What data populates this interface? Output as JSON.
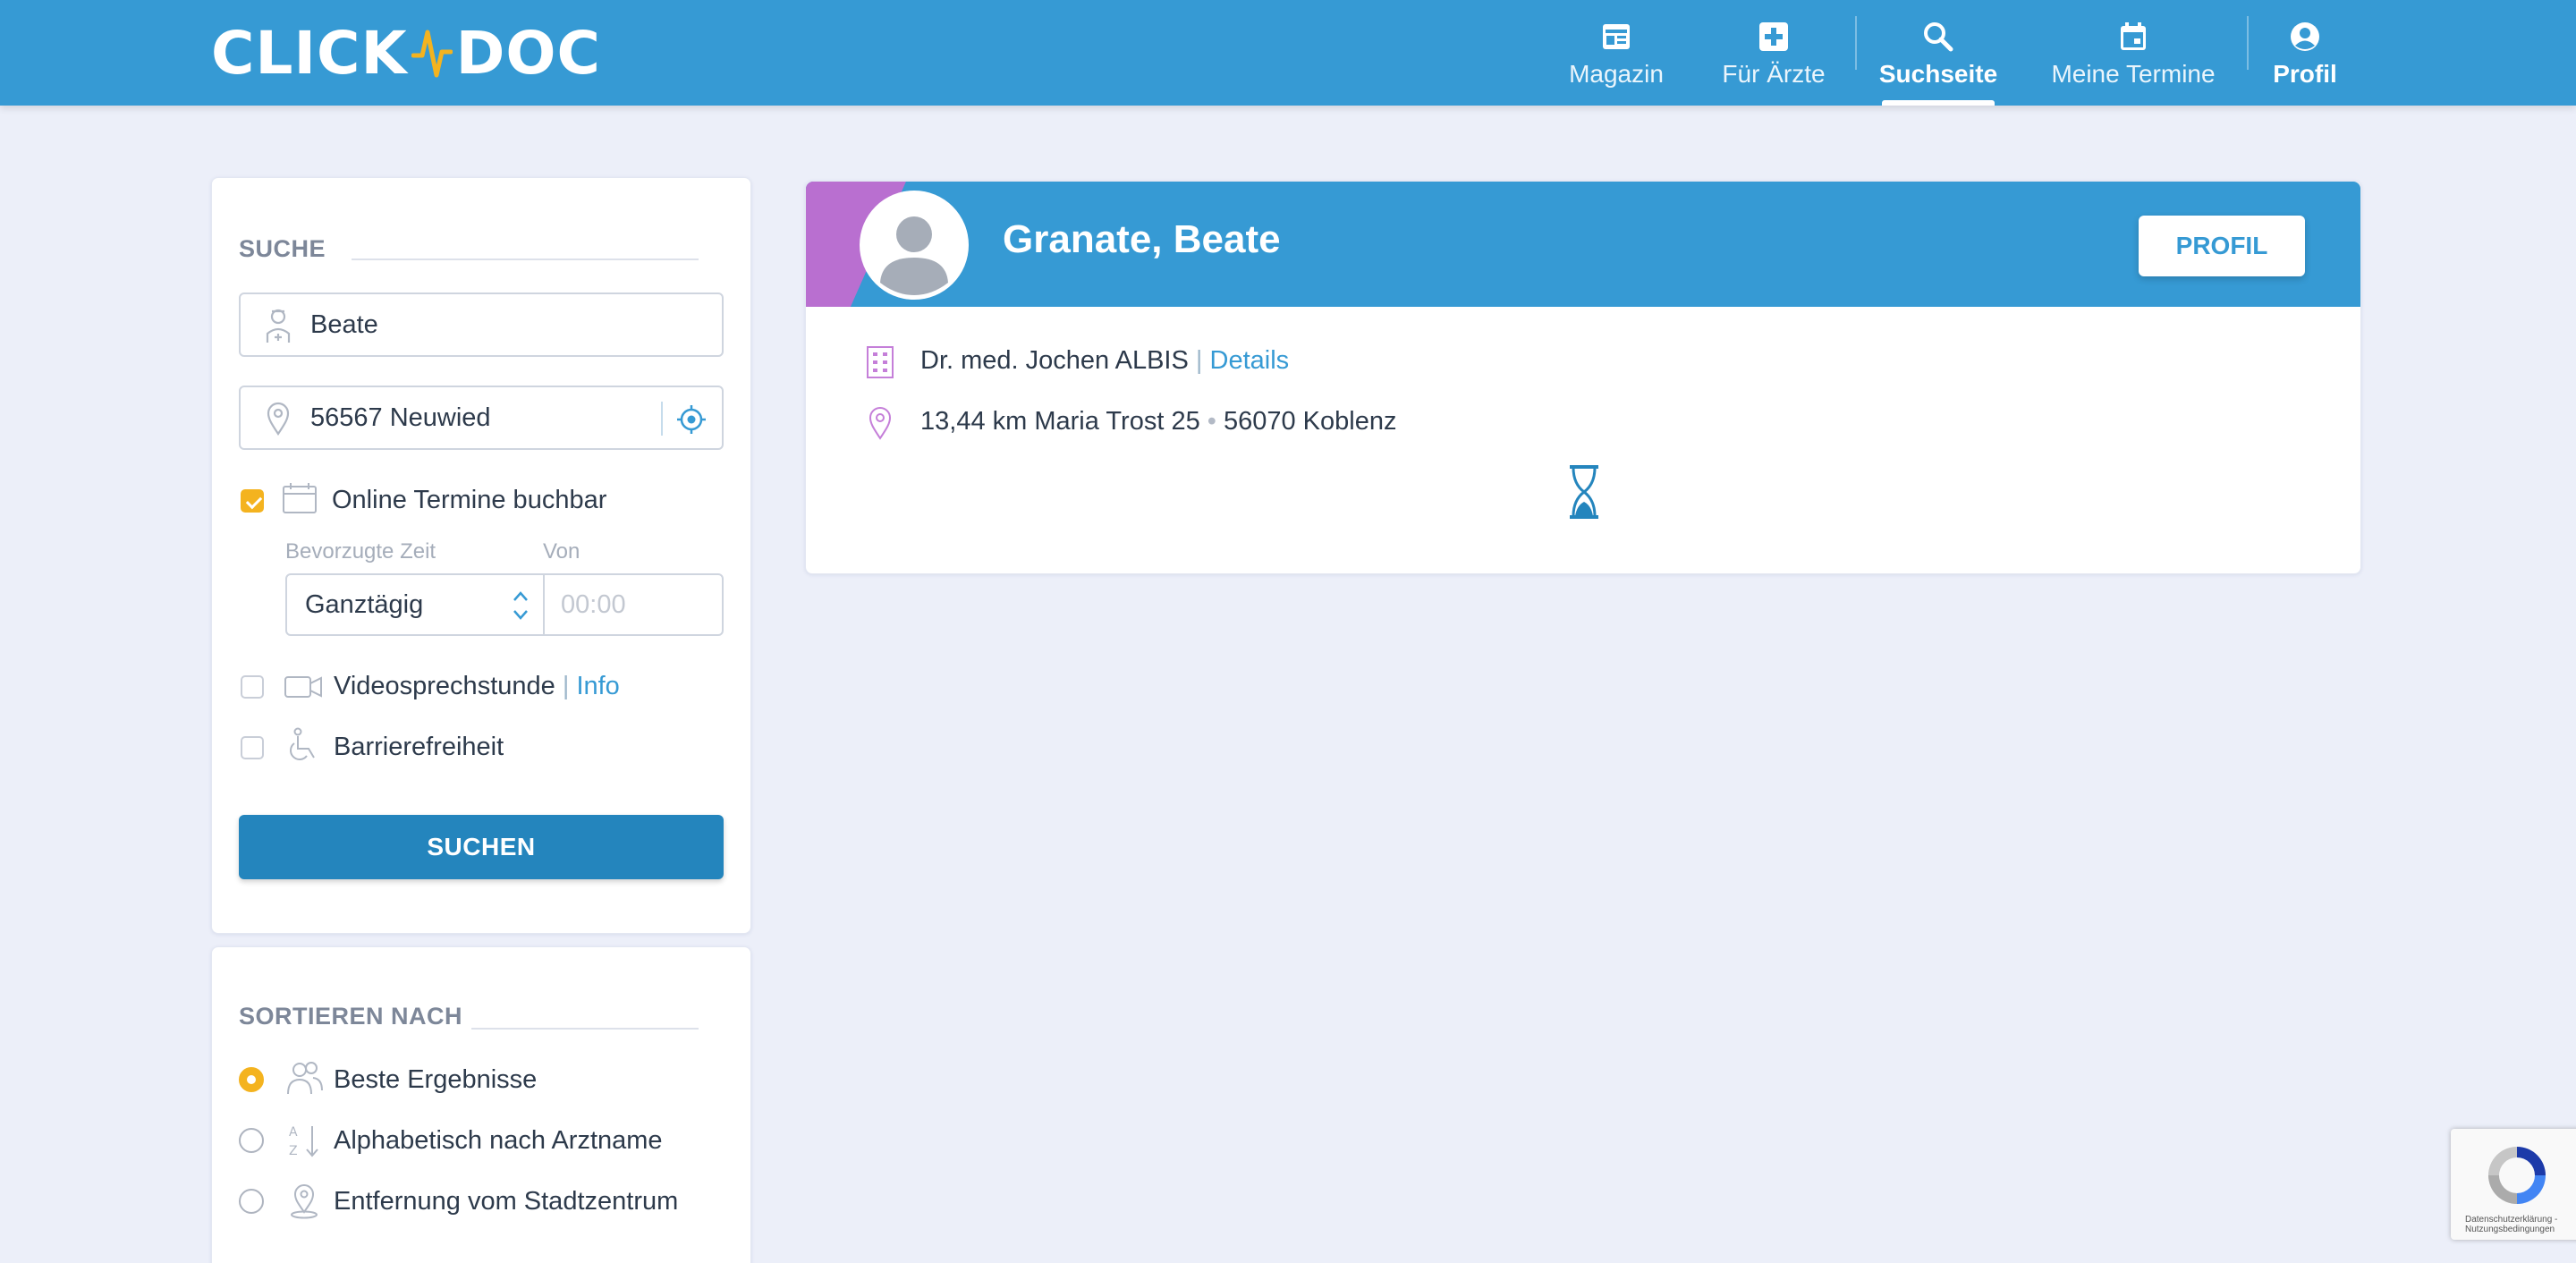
{
  "header": {
    "logo_left": "CLICK",
    "logo_right": "DOC",
    "nav": [
      {
        "label": "Magazin",
        "icon": "newspaper-icon"
      },
      {
        "label": "Für Ärzte",
        "icon": "medical-cross-icon"
      },
      {
        "label": "Suchseite",
        "icon": "search-icon",
        "active": true
      },
      {
        "label": "Meine Termine",
        "icon": "calendar-icon"
      },
      {
        "label": "Profil",
        "icon": "user-circle-icon"
      }
    ]
  },
  "search": {
    "title": "SUCHE",
    "name_value": "Beate",
    "location_value": "56567 Neuwied",
    "online_label": "Online Termine buchbar",
    "online_checked": true,
    "time_label": "Bevorzugte Zeit",
    "from_label": "Von",
    "time_value": "Ganztägig",
    "from_placeholder": "00:00",
    "video_label": "Videosprechstunde",
    "video_sep": "|",
    "video_info": "Info",
    "video_checked": false,
    "barrier_label": "Barrierefreiheit",
    "barrier_checked": false,
    "button_label": "SUCHEN"
  },
  "sort": {
    "title": "SORTIEREN NACH",
    "options": [
      {
        "label": "Beste Ergebnisse",
        "selected": true
      },
      {
        "label": "Alphabetisch nach Arztname",
        "selected": false
      },
      {
        "label": "Entfernung vom Stadtzentrum",
        "selected": false
      }
    ]
  },
  "result": {
    "name": "Granate, Beate",
    "profile_button": "PROFIL",
    "practice": "Dr. med. Jochen ALBIS",
    "practice_sep": "|",
    "details_link": "Details",
    "distance": "13,44 km",
    "street": "Maria Trost 25",
    "dot": "•",
    "city": "56070 Koblenz"
  },
  "recaptcha": {
    "text": "Datenschutzerklärung - Nutzungsbedingungen"
  },
  "colors": {
    "brand_blue": "#369ad4",
    "button_blue": "#2485bd",
    "accent_yellow": "#f4b31f",
    "accent_purple": "#b96fd0",
    "background": "#eceff9"
  }
}
